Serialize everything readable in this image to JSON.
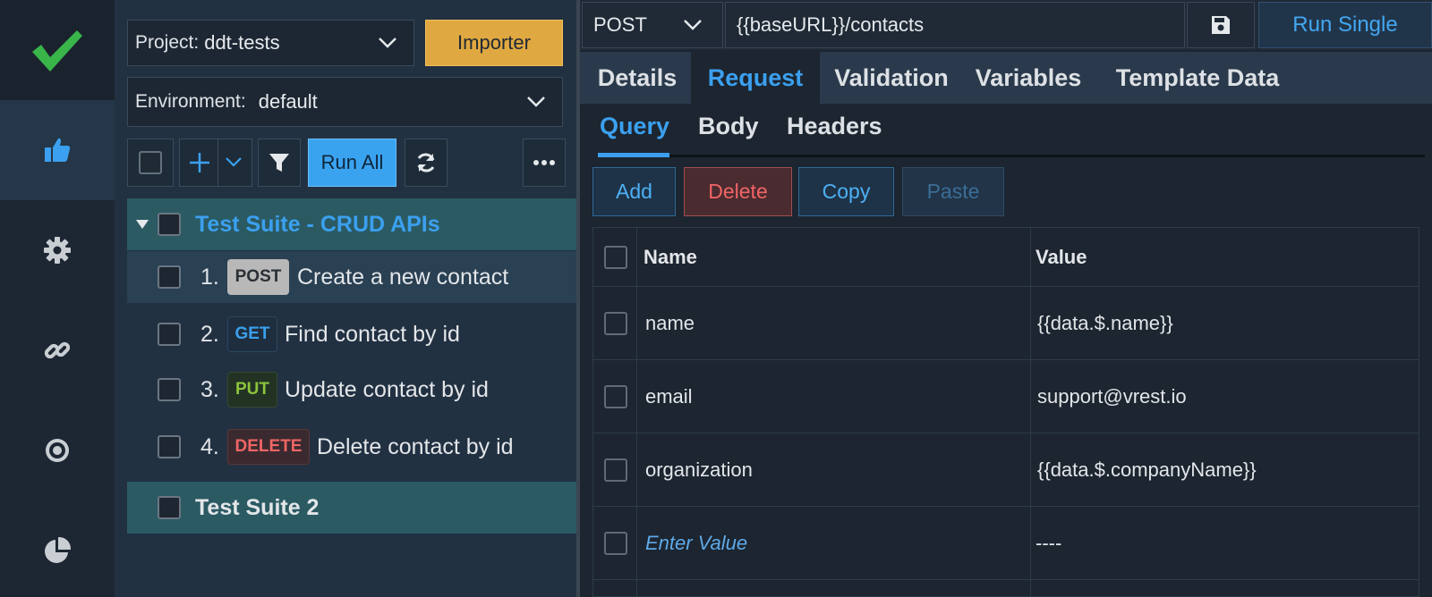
{
  "colors": {
    "accent": "#3ba0ef",
    "importer": "#e0a840",
    "post": "#c8c8c8",
    "get": "#3ba0ef",
    "put": "#8cc43c",
    "delete": "#f16565",
    "logo": "#39b54a"
  },
  "rail": {
    "icons": [
      "check-logo-icon",
      "thumbs-up-icon",
      "gear-icon",
      "link-icon",
      "target-icon",
      "pie-chart-icon"
    ]
  },
  "project": {
    "label": "Project:",
    "value": "ddt-tests"
  },
  "importer_label": "Importer",
  "environment": {
    "label": "Environment:",
    "value": "default"
  },
  "toolbar": {
    "run_all": "Run All"
  },
  "tree": {
    "suite1": "Test Suite - CRUD APIs",
    "suite2": "Test Suite 2",
    "items": [
      {
        "num": "1.",
        "method": "POST",
        "title": "Create a new contact"
      },
      {
        "num": "2.",
        "method": "GET",
        "title": "Find contact by id"
      },
      {
        "num": "3.",
        "method": "PUT",
        "title": "Update contact by id"
      },
      {
        "num": "4.",
        "method": "DELETE",
        "title": "Delete contact by id"
      }
    ]
  },
  "request": {
    "method": "POST",
    "url": "{{baseURL}}/contacts",
    "run_single": "Run Single"
  },
  "tabs": [
    "Details",
    "Request",
    "Validation",
    "Variables",
    "Template Data"
  ],
  "subtabs": [
    "Query",
    "Body",
    "Headers"
  ],
  "actions": {
    "add": "Add",
    "delete": "Delete",
    "copy": "Copy",
    "paste": "Paste"
  },
  "grid": {
    "headers": [
      "Name",
      "Value"
    ],
    "rows": [
      {
        "name": "name",
        "value": "{{data.$.name}}"
      },
      {
        "name": "email",
        "value": "support@vrest.io"
      },
      {
        "name": "organization",
        "value": "{{data.$.companyName}}"
      }
    ],
    "placeholder_name": "Enter Value",
    "placeholder_value": "----"
  }
}
